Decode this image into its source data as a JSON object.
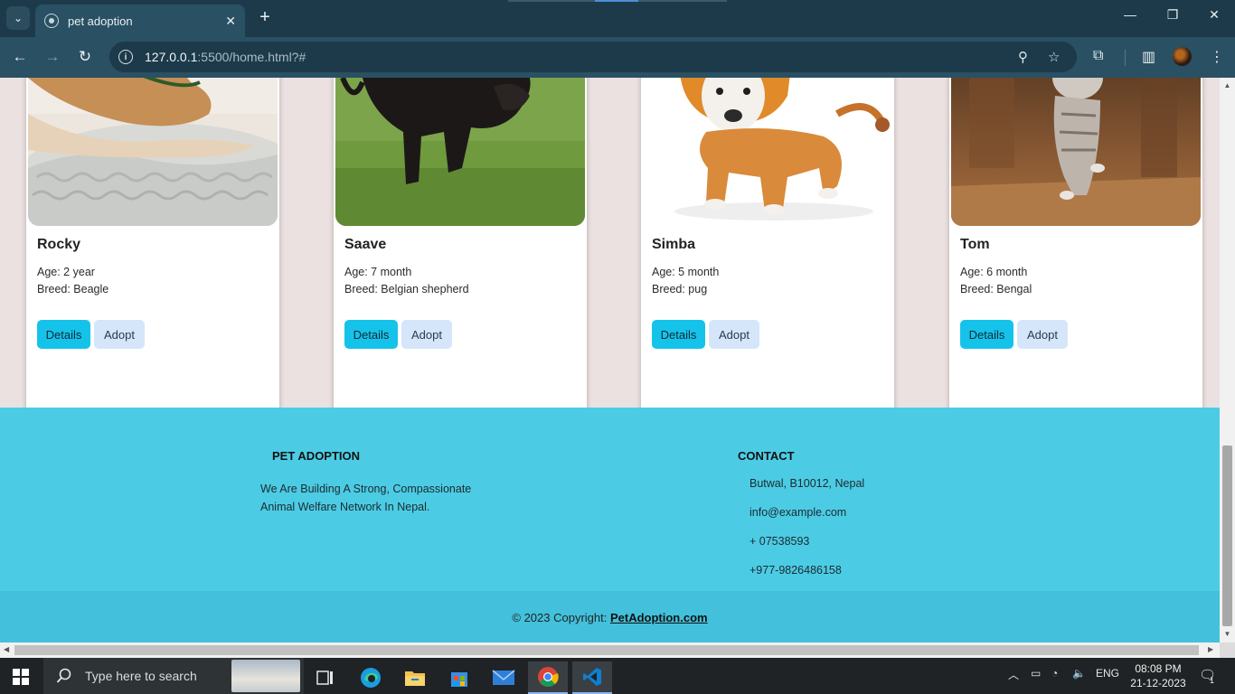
{
  "browser": {
    "tab_title": "pet adoption",
    "url_host": "127.0.0.1",
    "url_rest": ":5500/home.html?#"
  },
  "pets": [
    {
      "name": "Rocky",
      "age": "Age: 2 year",
      "breed": "Breed: Beagle"
    },
    {
      "name": "Saave",
      "age": "Age: 7 month",
      "breed": "Breed: Belgian shepherd"
    },
    {
      "name": "Simba",
      "age": "Age: 5 month",
      "breed": "Breed: pug"
    },
    {
      "name": "Tom",
      "age": "Age: 6 month",
      "breed": "Breed: Bengal"
    }
  ],
  "card_buttons": {
    "details": "Details",
    "adopt": "Adopt"
  },
  "footer": {
    "about_title": "PET ADOPTION",
    "about_line1": "We Are Building A Strong, Compassionate",
    "about_line2": "Animal Welfare Network In Nepal.",
    "contact_title": "CONTACT",
    "address": "Butwal, B10012, Nepal",
    "email": "info@example.com",
    "phone1": "+ 07538593",
    "phone2": "+977-9826486158",
    "copyright_prefix": "© 2023 Copyright: ",
    "copyright_link": "PetAdoption.com"
  },
  "taskbar": {
    "search_placeholder": "Type here to search",
    "language": "ENG",
    "time": "08:08 PM",
    "date": "21-12-2023",
    "notification_count": "1"
  },
  "colors": {
    "page_bg": "#ebe1e1",
    "footer_bg": "#4ccce4",
    "details_button": "#15c3ea",
    "adopt_button": "#d5e6fb"
  }
}
